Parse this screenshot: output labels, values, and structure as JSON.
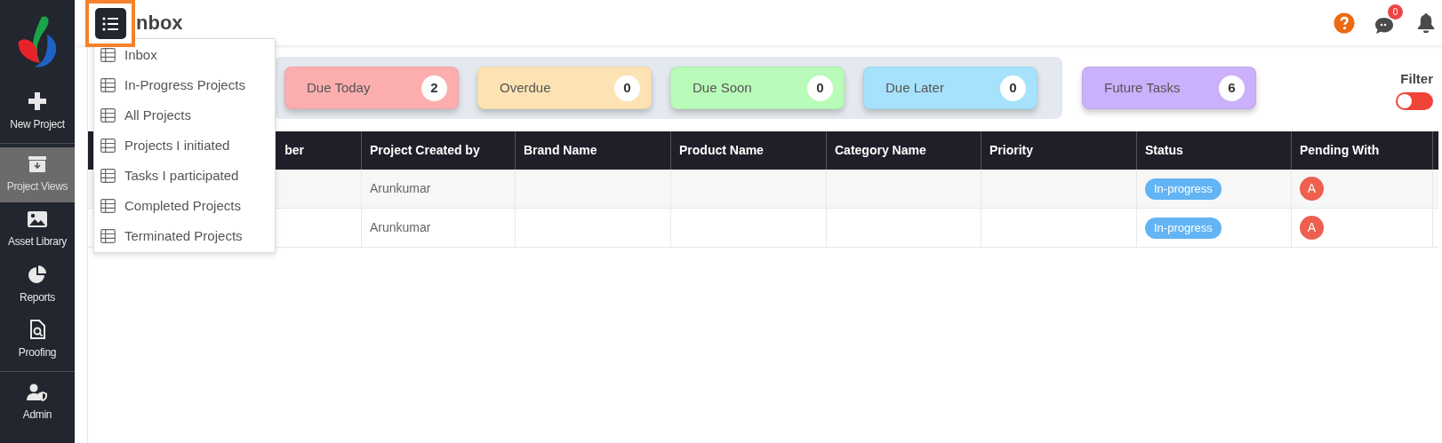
{
  "sidebar": {
    "items": [
      {
        "label": "New Project",
        "kind": "plus",
        "selected": false
      },
      {
        "label": "Project Views",
        "kind": "archive",
        "selected": true
      },
      {
        "label": "Asset Library",
        "kind": "image",
        "selected": false
      },
      {
        "label": "Reports",
        "kind": "pie",
        "selected": false
      },
      {
        "label": "Proofing",
        "kind": "proof",
        "selected": false
      },
      {
        "label": "Admin",
        "kind": "admin",
        "selected": false
      }
    ]
  },
  "header": {
    "title": "nbox",
    "chat_count": "0"
  },
  "menu": {
    "items": [
      {
        "label": "Inbox",
        "selected": false
      },
      {
        "label": "In-Progress Projects",
        "selected": false
      },
      {
        "label": "All Projects",
        "selected": false
      },
      {
        "label": "Projects I initiated",
        "selected": false
      },
      {
        "label": "Tasks I participated",
        "selected": false
      },
      {
        "label": "Completed Projects",
        "selected": false
      },
      {
        "label": "Terminated Projects",
        "selected": false
      }
    ]
  },
  "cards": [
    {
      "label": "Due Today",
      "count": "2",
      "color": "#fcaeae"
    },
    {
      "label": "Overdue",
      "count": "0",
      "color": "#fde3b3"
    },
    {
      "label": "Due Soon",
      "count": "0",
      "color": "#b9fbb9"
    },
    {
      "label": "Due Later",
      "count": "0",
      "color": "#a6e2fb"
    }
  ],
  "future_card": {
    "label": "Future Tasks",
    "count": "6",
    "color": "#cbb0fc"
  },
  "filter": {
    "label": "Filter",
    "on": false
  },
  "table": {
    "columns": [
      "ber",
      "Project Created by",
      "Brand Name",
      "Product Name",
      "Category Name",
      "Priority",
      "Status",
      "Pending With"
    ],
    "rows": [
      {
        "created_by": "Arunkumar",
        "status": "In-progress",
        "pending": "A"
      },
      {
        "created_by": "Arunkumar",
        "status": "In-progress",
        "pending": "A"
      }
    ]
  }
}
